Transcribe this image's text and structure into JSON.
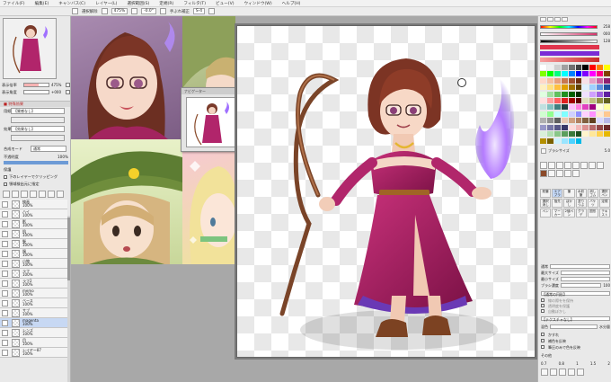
{
  "menu": [
    "ファイル(F)",
    "編集(E)",
    "キャンバス(C)",
    "レイヤー(L)",
    "選択範囲(S)",
    "定規(R)",
    "フィルタ(T)",
    "ビュー(V)",
    "ウィンドウ(W)",
    "ヘルプ(H)"
  ],
  "toolbar": {
    "selection_label": "選択解除",
    "zoom": "475%",
    "angle": "-0.0°",
    "stabilizer_label": "手ぶれ補正",
    "stabilizer_value": "S-4"
  },
  "left_panel": {
    "zoom_label": "表示倍率",
    "zoom_value": "475%",
    "angle_label": "表示角度",
    "angle_value": "+000",
    "section_effect": "■ 特殊効果",
    "texture_label": "用紙",
    "texture_value": "【質感なし】",
    "effect_label": "効果",
    "effect_value": "【効果なし】",
    "blend_label": "合成モード",
    "blend_value": "通常",
    "opacity_label": "不透明度",
    "opacity_value": "100%",
    "protect_label": "保護",
    "clipping_label": "下のレイヤーでクリッピング",
    "ref_label": "領域検出元に指定",
    "layers": [
      {
        "name": "線画",
        "mode": "通常",
        "opacity": "100%"
      },
      {
        "name": "ハイ",
        "mode": "通常",
        "opacity": "100%"
      },
      {
        "name": "影",
        "mode": "通常",
        "opacity": "100%"
      },
      {
        "name": "肌",
        "mode": "通常",
        "opacity": "100%"
      },
      {
        "name": "髪",
        "mode": "通常",
        "opacity": "100%"
      },
      {
        "name": "服",
        "mode": "通常",
        "opacity": "100%"
      },
      {
        "name": "小物",
        "mode": "通常",
        "opacity": "100%"
      },
      {
        "name": "ラフ",
        "mode": "通常",
        "opacity": "100%"
      },
      {
        "name": "ラフ2",
        "mode": "通常",
        "opacity": "100%"
      },
      {
        "name": "memo",
        "mode": "通常",
        "opacity": "100%"
      },
      {
        "name": "ベース",
        "mode": "通常",
        "opacity": "100%"
      },
      {
        "name": "サブ",
        "mode": "通常",
        "opacity": "100%"
      },
      {
        "name": "magenta",
        "mode": "通常",
        "opacity": "100%"
      },
      {
        "name": "レンズ",
        "mode": "通常",
        "opacity": "100%"
      },
      {
        "name": "目",
        "mode": "通常",
        "opacity": "100%"
      },
      {
        "name": "レイヤー87",
        "mode": "通常",
        "opacity": "100%"
      }
    ]
  },
  "float_nav_title": "ナビゲーター",
  "right_panel": {
    "sliders": [
      {
        "label": "H",
        "value": "258",
        "color": "#d6346b"
      },
      {
        "label": "S",
        "value": "000",
        "color": "#8c8c8c"
      },
      {
        "label": "V",
        "value": "128",
        "color": "#c0c0c0"
      },
      {
        "label": "",
        "value": "",
        "color": "#e0344c"
      },
      {
        "label": "",
        "value": "",
        "color": "#7a2bd6"
      }
    ],
    "palette": [
      "#ffffff",
      "#f0f0f0",
      "#d0d0d0",
      "#a0a0a0",
      "#707070",
      "#404040",
      "#000000",
      "#ff0000",
      "#ff8000",
      "#ffff00",
      "#80ff00",
      "#00ff00",
      "#00ff80",
      "#00ffff",
      "#0080ff",
      "#0000ff",
      "#8000ff",
      "#ff00ff",
      "#ff0080",
      "#804000",
      "#ffd8c8",
      "#f7c0a0",
      "#e8a07c",
      "#c87850",
      "#a05030",
      "#703010",
      "#f8e0e8",
      "#e8a0c8",
      "#c860a0",
      "#902070",
      "#fff0c0",
      "#ffe080",
      "#ffc040",
      "#e0a000",
      "#a07000",
      "#604000",
      "#e0f0ff",
      "#a0d0ff",
      "#6090e0",
      "#2050a0",
      "#e0ffe0",
      "#a0e0a0",
      "#60c060",
      "#209020",
      "#006000",
      "#003000",
      "#f0e0ff",
      "#d0a0ff",
      "#a060e0",
      "#6020a0",
      "#ffe0e0",
      "#ffa0a0",
      "#ff6060",
      "#e02020",
      "#a00000",
      "#600000",
      "#e0e0c0",
      "#c0c080",
      "#909040",
      "#606020",
      "#c0e0e0",
      "#80c0c0",
      "#408080",
      "#204040",
      "#ffc0ff",
      "#ff80e0",
      "#e040c0",
      "#a00080",
      "#ffffe0",
      "#ffffa0",
      "#d0ffd0",
      "#90ff90",
      "#c0ffff",
      "#80ffff",
      "#d0d0ff",
      "#9090ff",
      "#ffd0ff",
      "#ff90ff",
      "#ffe8d0",
      "#ffc890",
      "#b0b0b0",
      "#909090",
      "#606060",
      "#e8c8b0",
      "#d0a080",
      "#b08060",
      "#806040",
      "#604020",
      "#d8d8ff",
      "#b8b8e8",
      "#9898c8",
      "#7878a8",
      "#585888",
      "#383868",
      "#ffdada",
      "#f3b8b8",
      "#dd9292",
      "#b86a6a",
      "#924747",
      "#6d2a2a",
      "#d9f0d9",
      "#b3e0b3",
      "#88c788",
      "#5c9e5c",
      "#3b7a3b",
      "#1f4f1f",
      "#fff5cc",
      "#ffe799",
      "#ffd24d",
      "#e6b800",
      "#b38f00",
      "#7a6100",
      "#ccf2ff",
      "#99e5ff",
      "#4dd2ff",
      "#00b8e6"
    ],
    "brush_size_label": "ブラシサイズ",
    "brush_size": "5.0",
    "brushes": [
      "鉛筆",
      "エアブラシ",
      "筆",
      "水彩筆",
      "消しゴム",
      "選択ペン",
      "選択消し",
      "指先",
      "ぼかし",
      "塗りつぶし",
      "バケツ",
      "定規",
      "ペン",
      "マーカー",
      "2値ペン",
      "グラデ",
      "図形",
      "テキスト"
    ],
    "mode_label": "通常",
    "max_size_label": "最大サイズ",
    "min_size_label": "最小サイズ",
    "density_label": "ブラシ濃度",
    "density_value": "100",
    "shape_label": "【通常の円形】",
    "texture_label": "【テクスチャなし】",
    "mix_label": "混色",
    "blend_amount_label": "水分量",
    "extra_options": [
      "線の際をを保持",
      "透明度を保護",
      "自動ぼかし"
    ],
    "bottom_checks": [
      "かすれ",
      "補色を反映",
      "筆圧のみで色を反映"
    ],
    "other_label": "その他",
    "size_scale": [
      "0.7",
      "0.8",
      "1",
      "1.5",
      "2"
    ]
  }
}
